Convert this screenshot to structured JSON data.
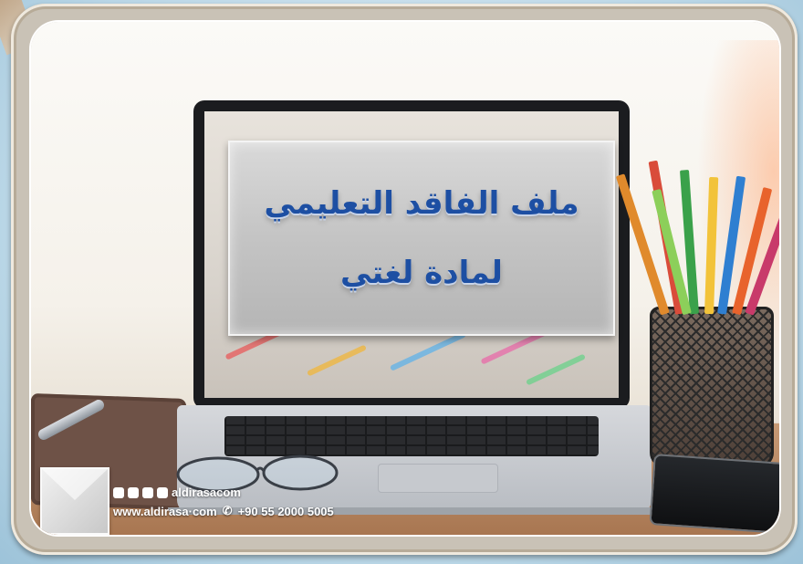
{
  "title": {
    "line1": "ملف الفاقد التعليمي",
    "line2": "لمادة لغتي"
  },
  "brand": {
    "social_handle": "aldirasacom",
    "website": "www.aldirasa·com",
    "phone": "+90 55 2000 5005",
    "icons": [
      "facebook-icon",
      "twitter-icon",
      "instagram-icon",
      "youtube-icon",
      "phone-icon"
    ]
  },
  "colors": {
    "title_text": "#1d4fa3",
    "card_bg": "#c4c4c4",
    "frame": "#c9c2b6"
  }
}
